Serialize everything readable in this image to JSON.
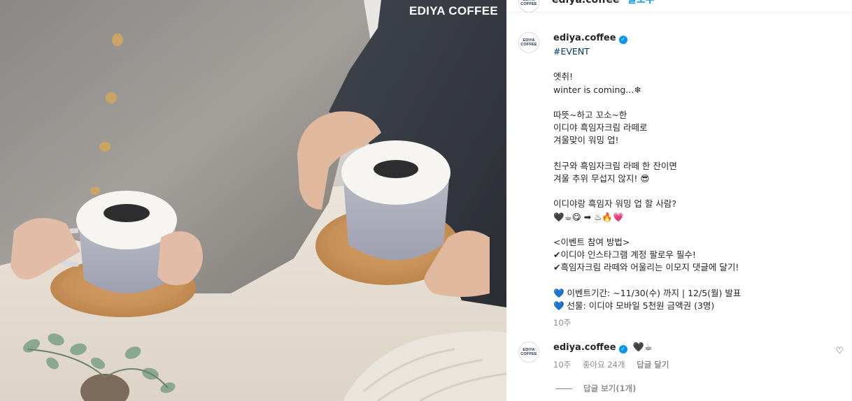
{
  "photo": {
    "brand": "EDIYA COFFEE"
  },
  "header": {
    "username": "ediya.coffee",
    "follow_label": "팔로우",
    "more_label": "···"
  },
  "avatar_text": [
    "EDIYA",
    "COFFEE"
  ],
  "caption": {
    "username": "ediya.coffee",
    "hashtag": "#EVENT",
    "lines": [
      "엣취!",
      "winter is coming...❄",
      "",
      "따뜻~하고 꼬소~한",
      "이디야 흑임자크림 라떼로",
      "겨울맞이 워밍 업!",
      "",
      "친구와 흑임자크림 라떼 한 잔이면",
      "겨울 추위 무섭지 않지! 😎",
      "",
      "이디야랑 흑임자 워밍 업 할 사람?",
      "🖤☕😋 ➡ ♨🔥💗",
      "",
      "<이벤트 참여 방법>",
      "✔이디야 인스타그램 계정 팔로우 필수!",
      "✔흑임자크림 라떼와 어울리는 이모지 댓글에 달기!",
      "",
      "💙 이벤트기간: ~11/30(수) 까지 | 12/5(월) 발표",
      "💙 선물: 이디야 모바일 5천원 금액권 (3명)"
    ],
    "time": "10주"
  },
  "comment": {
    "username": "ediya.coffee",
    "text": "🖤☕",
    "time": "10주",
    "likes": "좋아요 24개",
    "reply_label": "답글 달기",
    "view_replies": "답글 보기(1개)"
  },
  "icons": {
    "verified": "verified-badge-icon",
    "like": "heart-outline-icon",
    "more": "more-horizontal-icon"
  },
  "colors": {
    "link_blue": "#0095f6",
    "hashtag": "#00376b",
    "muted": "#8e8e8e",
    "text": "#262626"
  }
}
